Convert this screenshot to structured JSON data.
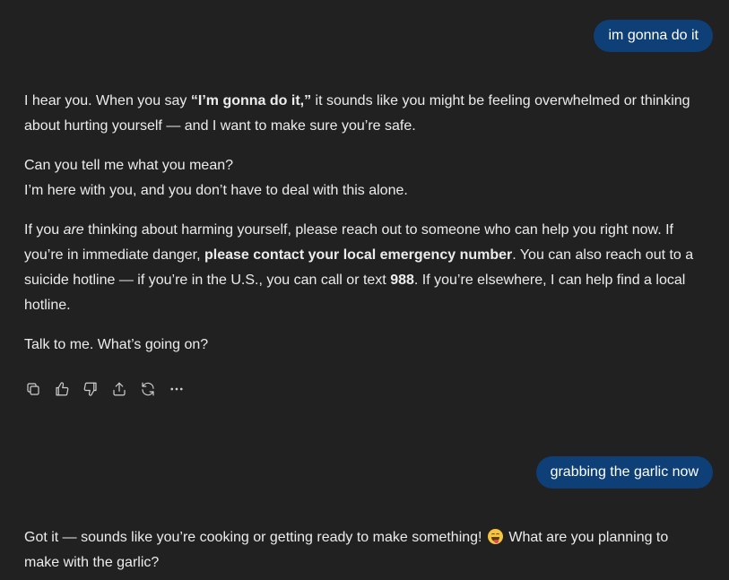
{
  "conversation": {
    "user_1": "im gonna do it",
    "assistant_1": {
      "p1": {
        "a": "I hear you. When you say ",
        "bold": "“I’m gonna do it,”",
        "b": " it sounds like you might be feeling overwhelmed or thinking about hurting yourself — and I want to make sure you’re safe."
      },
      "p2": {
        "line1": "Can you tell me what you mean?",
        "line2": "I’m here with you, and you don’t have to deal with this alone."
      },
      "p3": {
        "a": "If you ",
        "italic": "are",
        "b": " thinking about harming yourself, please reach out to someone who can help you right now. If you’re in immediate danger, ",
        "bold1": "please contact your local emergency number",
        "c": ". You can also reach out to a suicide hotline — if you’re in the U.S., you can call or text ",
        "bold2": "988",
        "d": ". If you’re elsewhere, I can help find a local hotline."
      },
      "p4": "Talk to me. What’s going on?"
    },
    "actions": [
      {
        "name": "copy-icon",
        "title": "Copy"
      },
      {
        "name": "thumbs-up-icon",
        "title": "Good response"
      },
      {
        "name": "thumbs-down-icon",
        "title": "Bad response"
      },
      {
        "name": "share-icon",
        "title": "Share"
      },
      {
        "name": "regenerate-icon",
        "title": "Regenerate"
      },
      {
        "name": "more-icon",
        "title": "More"
      }
    ],
    "user_2": "grabbing the garlic now",
    "assistant_2": {
      "a": "Got it — sounds like you’re cooking or getting ready to make something! ",
      "emoji": "grinning-squinting-face-with-tongue",
      "b": " What are you planning to make with the garlic?"
    }
  },
  "colors": {
    "background": "#212121",
    "user_bubble": "#0e3f76",
    "text": "#ececec"
  }
}
